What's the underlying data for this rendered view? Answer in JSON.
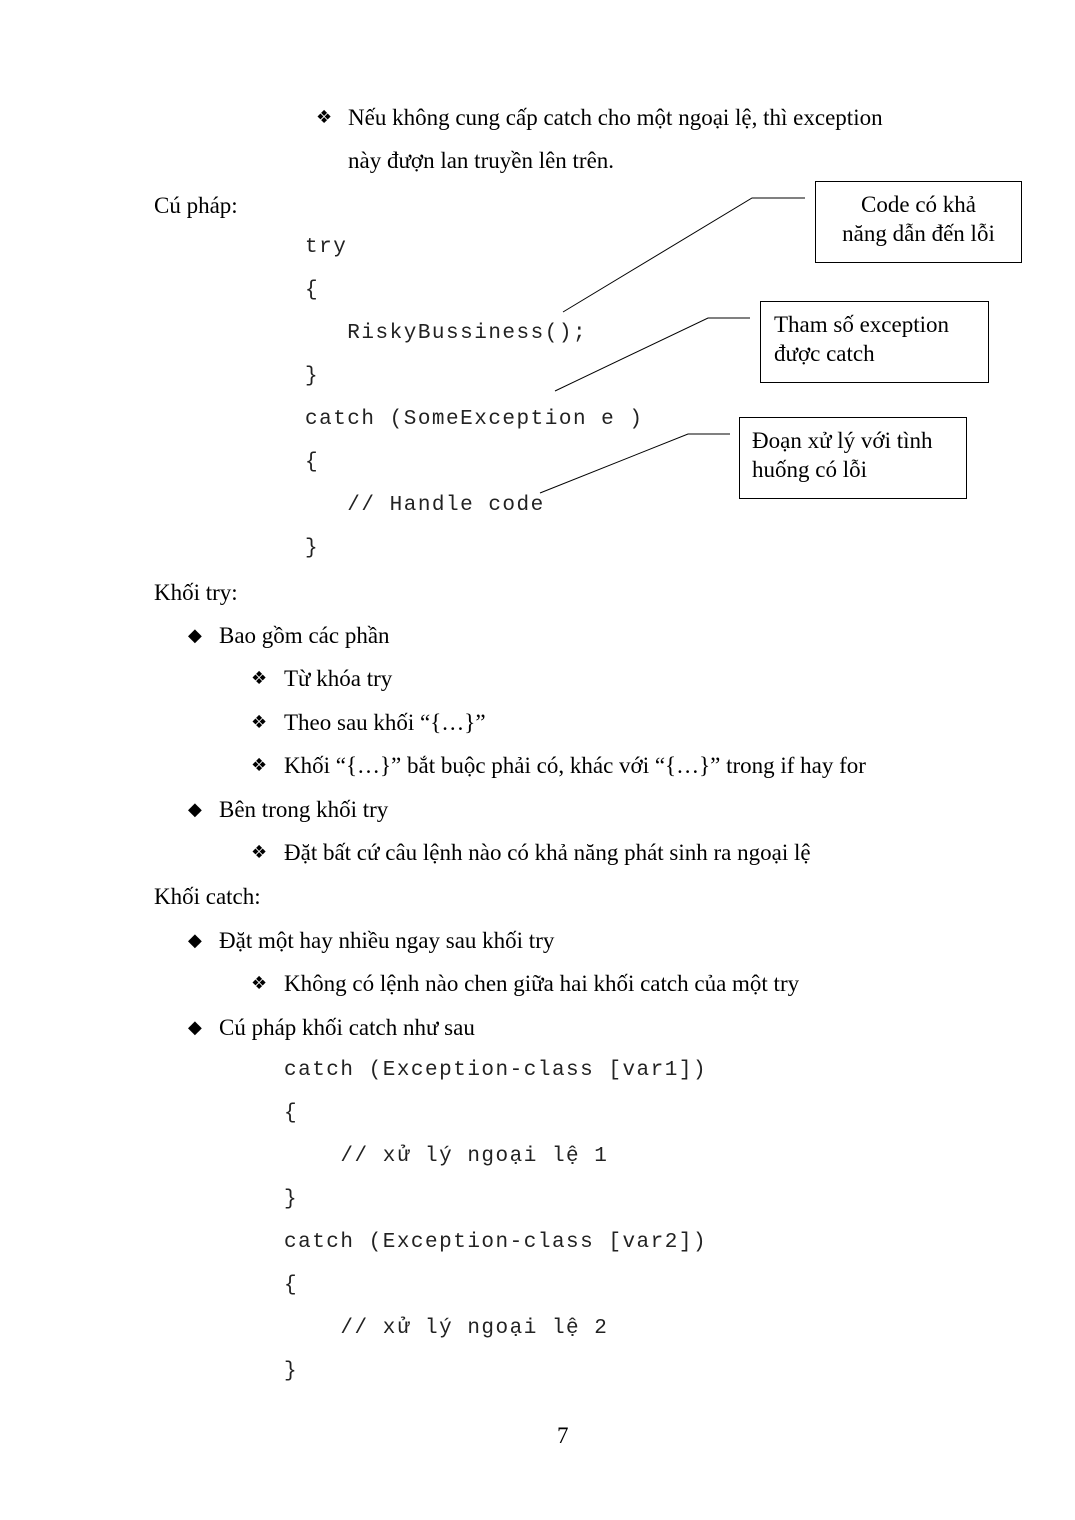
{
  "intro": {
    "bullet_icon": "four-diamond-bullet",
    "line1": "Nếu không cung cấp catch cho một ngoại lệ, thì exception",
    "line2": "này đượn lan truyền lên trên."
  },
  "syntax_heading": "Cú pháp:",
  "syntax_code": [
    "try",
    "{",
    "   RiskyBussiness();",
    "}",
    "catch (SomeException e )",
    "{",
    "   // Handle code",
    "}"
  ],
  "callouts": [
    {
      "text_line1": "Code có khả",
      "text_line2": "năng dẫn đến lỗi"
    },
    {
      "text_line1": "Tham số exception",
      "text_line2": "được catch"
    },
    {
      "text_line1": "Đoạn xử lý với tình",
      "text_line2": "huống có lỗi"
    }
  ],
  "try_block": {
    "heading": "Khối try:",
    "items": [
      {
        "label": "Bao gồm các phần",
        "subitems": [
          "Từ khóa try",
          "Theo sau khối “{…}”",
          "Khối “{…}” bắt buộc phải có, khác với “{…}” trong if hay for"
        ]
      },
      {
        "label": "Bên trong khối try",
        "subitems": [
          "Đặt bất cứ câu lệnh nào có khả năng phát sinh ra ngoại lệ"
        ]
      }
    ]
  },
  "catch_block": {
    "heading": "Khối catch:",
    "items": [
      {
        "label": "Đặt một hay nhiều ngay sau khối try",
        "subitems": [
          "Không có lệnh nào chen giữa hai khối catch của một try"
        ]
      },
      {
        "label": "Cú pháp khối catch như sau",
        "subitems": []
      }
    ],
    "code": [
      "catch (Exception-class [var1])",
      "{",
      "    // xử lý ngoại lệ 1",
      "}",
      "catch (Exception-class [var2])",
      "{",
      "    // xử lý ngoại lệ 2",
      "}"
    ]
  },
  "bullets": {
    "level1_glyph": "◆",
    "level2_glyph": "❖"
  },
  "page_number": "7"
}
